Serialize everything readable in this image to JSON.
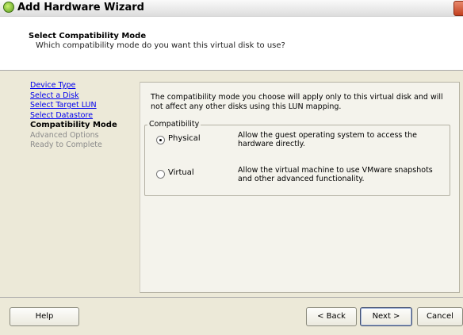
{
  "window": {
    "title": "Add Hardware Wizard",
    "icon": "wizard-gem-icon",
    "close_icon": "close-icon"
  },
  "header": {
    "title": "Select Compatibility Mode",
    "subtitle": "Which compatibility mode do you want this virtual disk to use?"
  },
  "steps": [
    {
      "label": "Device Type",
      "state": "link"
    },
    {
      "label": "Select a Disk",
      "state": "link"
    },
    {
      "label": "Select Target LUN",
      "state": "link"
    },
    {
      "label": "Select Datastore",
      "state": "link"
    },
    {
      "label": "Compatibility Mode",
      "state": "current"
    },
    {
      "label": "Advanced Options",
      "state": "disabled"
    },
    {
      "label": "Ready to Complete",
      "state": "disabled"
    }
  ],
  "content": {
    "intro": "The compatibility mode you choose will apply only to this virtual disk and will not affect any other disks using this LUN mapping.",
    "group_label": "Compatibility",
    "options": [
      {
        "label": "Physical",
        "description": "Allow the guest operating system to access the hardware directly.",
        "selected": true
      },
      {
        "label": "Virtual",
        "description": "Allow the virtual machine to use VMware snapshots and other advanced functionality.",
        "selected": false
      }
    ]
  },
  "footer": {
    "help": "Help",
    "back": "< Back",
    "next": "Next >",
    "cancel": "Cancel"
  },
  "colors": {
    "link": "#0000ee",
    "disabled": "#8a8a8a",
    "header_bg": "#ffffff",
    "dialog_bg": "#ece9d8"
  }
}
